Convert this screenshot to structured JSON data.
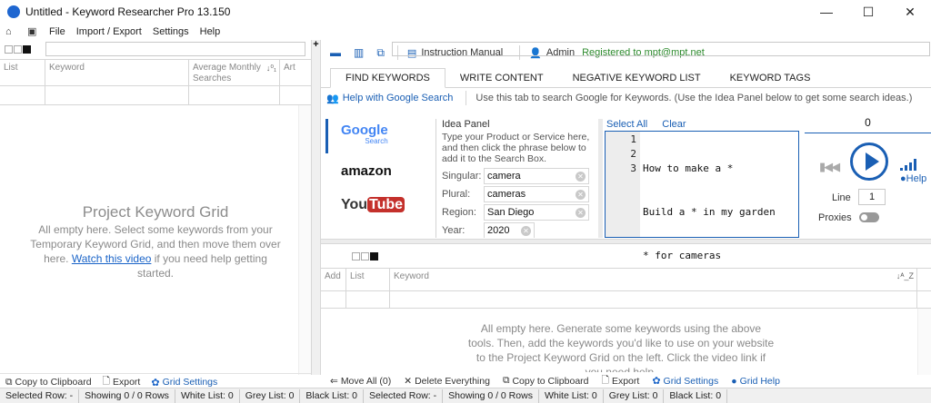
{
  "window": {
    "title": "Untitled - Keyword Researcher Pro 13.150",
    "controls": [
      "—",
      "☐",
      "✕"
    ]
  },
  "menu": {
    "items": [
      "File",
      "Import / Export",
      "Settings",
      "Help"
    ]
  },
  "left_panel": {
    "columns": [
      "List",
      "Keyword",
      "Average Monthly Searches",
      "Art"
    ],
    "sort_icon": "↓⁰₁",
    "empty_title": "Project Keyword Grid",
    "empty_text": "All empty here. Select some keywords from your Temporary Keyword Grid, and then move them over here.",
    "empty_link": "Watch this video",
    "empty_tail": "if you need help getting started.",
    "bottom_actions": [
      "Copy to Clipboard",
      "Export",
      "Grid Settings"
    ]
  },
  "toolbar": {
    "manual": "Instruction Manual",
    "admin": "Admin",
    "registered": "Registered to mpt@mpt.net"
  },
  "tabs": [
    "FIND KEYWORDS",
    "WRITE CONTENT",
    "NEGATIVE KEYWORD LIST",
    "KEYWORD TAGS"
  ],
  "help_row": {
    "link": "Help with Google Search",
    "hint": "Use this tab to search Google for Keywords. (Use the Idea Panel below to get some search ideas.)"
  },
  "engines": {
    "google": "Google",
    "google_sub": "Search",
    "amazon": "amazon",
    "youtube_a": "You",
    "youtube_b": "Tube"
  },
  "idea_panel": {
    "title": "Idea Panel",
    "desc": "Type your Product or Service here, and then click the phrase below to add it to the Search Box.",
    "fields": [
      {
        "label": "Singular:",
        "value": "camera"
      },
      {
        "label": "Plural:",
        "value": "cameras"
      },
      {
        "label": "Region:",
        "value": "San Diego"
      },
      {
        "label": "Year:",
        "value": "2020"
      }
    ]
  },
  "editor": {
    "select_all": "Select All",
    "clear": "Clear",
    "line_numbers": [
      "1",
      "2",
      "3"
    ],
    "lines": [
      "How to make a *",
      "Build a * in my garden",
      "* for cameras"
    ]
  },
  "player": {
    "counter": "0",
    "help": "Help",
    "line_label": "Line",
    "line_value": "1",
    "proxies_label": "Proxies"
  },
  "kw_grid": {
    "columns": [
      "Add",
      "List",
      "Keyword"
    ],
    "sort_icon": "↓ᴬ_Z",
    "empty_text": "All empty here. Generate some keywords using the above tools. Then, add the keywords you'd like to use on your website to the Project Keyword Grid on the left. Click the video link if you need help."
  },
  "right_bottom_actions": [
    "Move All (0)",
    "Delete Everything",
    "Copy to Clipboard",
    "Export",
    "Grid Settings",
    "Grid Help"
  ],
  "status": [
    "Selected Row: -",
    "Showing 0 / 0 Rows",
    "White List: 0",
    "Grey List: 0",
    "Black List: 0",
    "Selected Row: -",
    "Showing 0 / 0 Rows",
    "White List: 0",
    "Grey List: 0",
    "Black List: 0"
  ]
}
